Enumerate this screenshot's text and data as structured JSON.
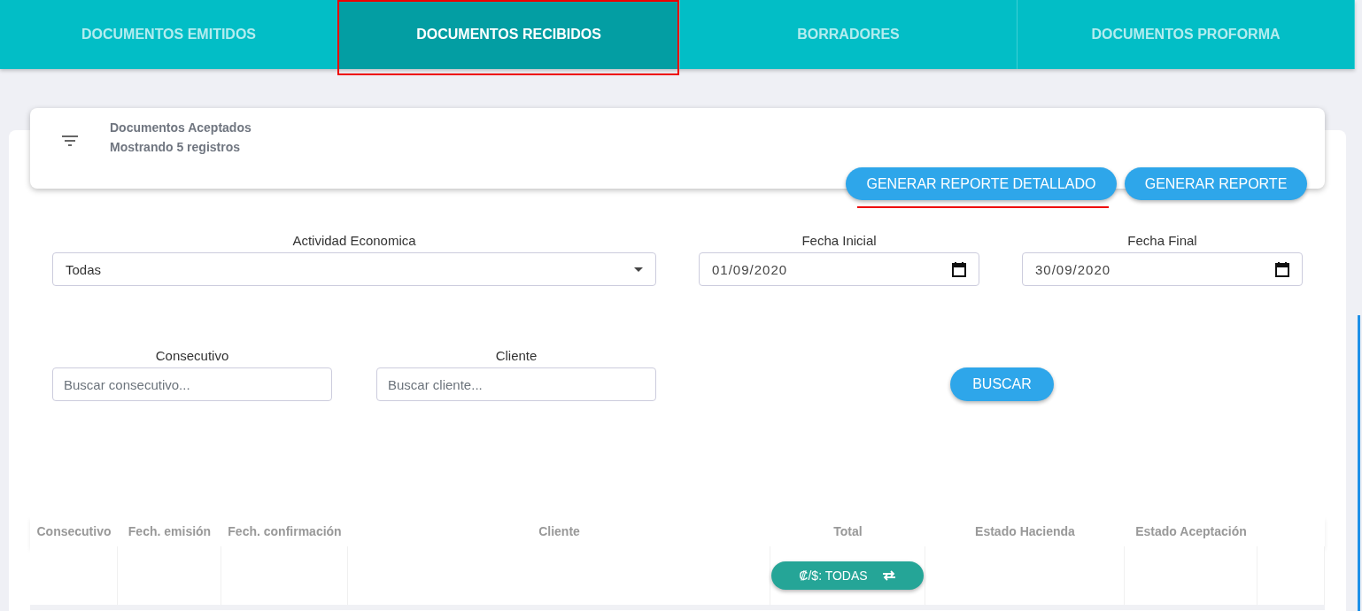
{
  "tabs": [
    {
      "label": "DOCUMENTOS EMITIDOS",
      "selected": false
    },
    {
      "label": "DOCUMENTOS RECIBIDOS",
      "selected": true
    },
    {
      "label": "BORRADORES",
      "selected": false
    },
    {
      "label": "DOCUMENTOS PROFORMA",
      "selected": false
    }
  ],
  "summary": {
    "title": "Documentos Aceptados",
    "count": "Mostrando 5 registros"
  },
  "report_buttons": [
    "GENERAR REPORTE DETALLADO",
    "GENERAR REPORTE"
  ],
  "filters": {
    "activity": {
      "label": "Actividad Economica",
      "value": "Todas"
    },
    "start_date": {
      "label": "Fecha Inicial",
      "value": "01/09/2020"
    },
    "end_date": {
      "label": "Fecha Final",
      "value": "30/09/2020"
    },
    "consecutive": {
      "label": "Consecutivo",
      "placeholder": "Buscar consecutivo..."
    },
    "client": {
      "label": "Cliente",
      "placeholder": "Buscar cliente..."
    },
    "search_button": "BUSCAR"
  },
  "table": {
    "columns": [
      "Consecutivo",
      "Fech. emisión",
      "Fech. confirmación",
      "Cliente",
      "Total",
      "Estado Hacienda",
      "Estado Aceptación"
    ],
    "currency_toggle": "₡/$: TODAS"
  }
}
